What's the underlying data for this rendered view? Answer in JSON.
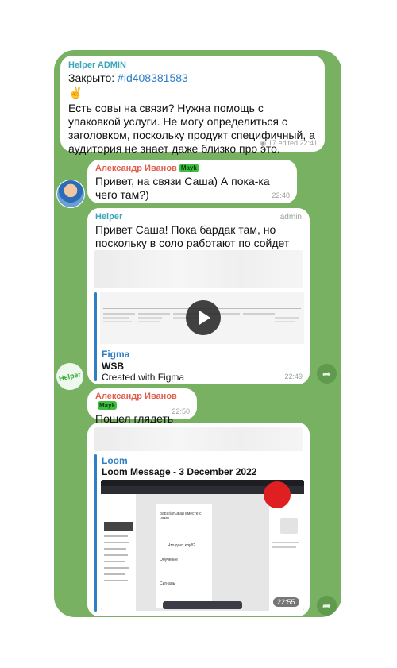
{
  "messages": [
    {
      "sender": "Helper ADMIN",
      "text_prefix": "Закрыто: ",
      "hashtag": "#id408381583",
      "emoji": "✌️",
      "text": "Есть совы на связи? Нужна помощь с упаковкой услуги. Не могу определиться с заголовком, поскольку продукт специфичный, а аудитория не знает даже близко про это.",
      "views": "17",
      "meta": "edited 22:41"
    },
    {
      "sender": "Александр Иванов",
      "badge": "Mayk",
      "text": "Привет, на связи Саша) А пока-ка чего там?)",
      "time": "22:48"
    },
    {
      "sender": "Helper",
      "role": "admin",
      "text": "Привет Саша! Пока бардак там, но поскольку в соло работают по сойдет",
      "emoji": "😊",
      "link": {
        "site": "Figma",
        "title": "WSB",
        "desc": "Created with Figma"
      },
      "time": "22:49"
    },
    {
      "sender": "Александр Иванов",
      "badge": "Mayk",
      "text": "Пошел глядеть",
      "time": "22:50"
    },
    {
      "link": {
        "site": "Loom",
        "title": "Loom Message - 3 December 2022"
      },
      "time": "22:55"
    }
  ],
  "loom_preview": {
    "heading": "Зарабатывай вместе с нами",
    "question": "Что дает клуб?",
    "section1": "Обучение",
    "section2": "Сигналы"
  },
  "helper_logo_text": "Helper",
  "icons": {
    "forward": "forward-arrow-icon",
    "play": "play-icon",
    "views": "eye-icon"
  },
  "colors": {
    "chat_bg": "#78b162",
    "link": "#2f7ec6",
    "sender_red": "#e0604e",
    "helper_teal": "#3aa6b7"
  }
}
